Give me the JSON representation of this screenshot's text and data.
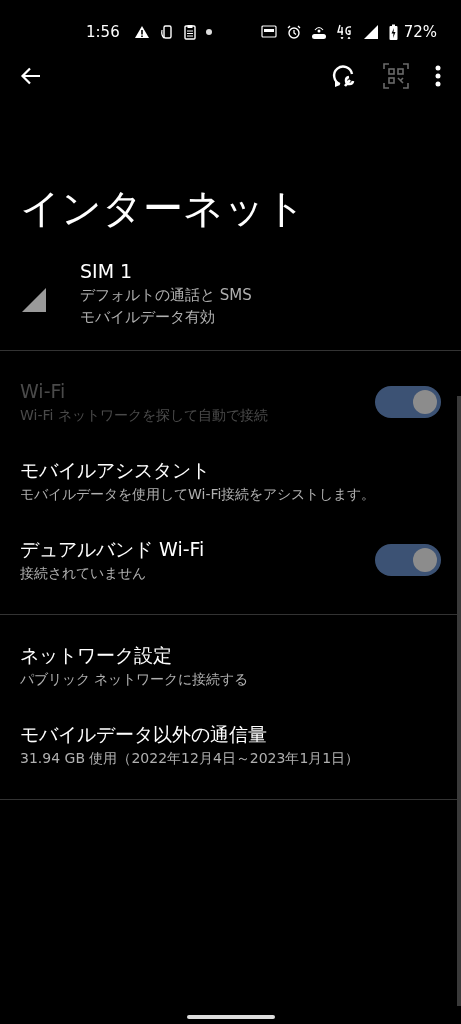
{
  "status_bar": {
    "time": "1:56",
    "battery": "72%"
  },
  "toolbar": {
    "qr_disabled": true
  },
  "title": "インターネット",
  "sim": {
    "name": "SIM 1",
    "lines": [
      "デフォルトの通話と SMS",
      "モバイルデータ有効"
    ]
  },
  "sections": [
    {
      "items": [
        {
          "kind": "toggle",
          "title": "Wi-Fi",
          "summary": "Wi-Fi ネットワークを探して自動で接続",
          "disabled": true,
          "on": true
        },
        {
          "kind": "plain",
          "title": "モバイルアシスタント",
          "summary": "モバイルデータを使用してWi-Fi接続をアシストします。",
          "disabled": false
        },
        {
          "kind": "toggle",
          "title": "デュアルバンド Wi-Fi",
          "summary": "接続されていません",
          "disabled": false,
          "on": true
        }
      ]
    },
    {
      "items": [
        {
          "kind": "plain",
          "title": "ネットワーク設定",
          "summary": "パブリック ネットワークに接続する",
          "disabled": false
        },
        {
          "kind": "plain",
          "title": "モバイルデータ以外の通信量",
          "summary": "31.94 GB 使用（2022年12月4日～2023年1月1日）",
          "disabled": false
        }
      ]
    }
  ]
}
